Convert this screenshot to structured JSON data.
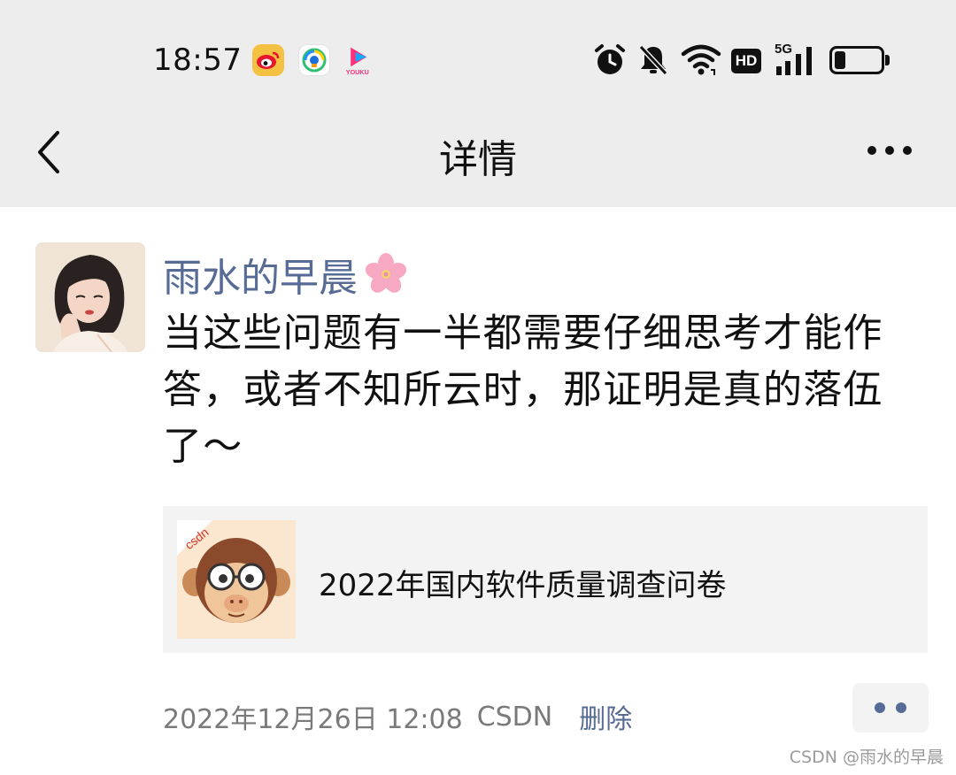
{
  "status_bar": {
    "time": "18:57",
    "apps": [
      {
        "icon": "weibo-icon"
      },
      {
        "icon": "qq-music-icon"
      },
      {
        "icon": "youku-icon",
        "label": "YOUKU"
      }
    ],
    "network": "5G",
    "hd_label": "HD",
    "battery_level": 0.2
  },
  "nav": {
    "title": "详情",
    "back_icon": "chevron-left-icon",
    "more_icon": "more-icon"
  },
  "post": {
    "username": "雨水的早晨",
    "username_emoji": "cherry-blossom-icon",
    "text": "当这些问题有一半都需要仔细思考才能作答，或者不知所云时，那证明是真的落伍了～",
    "share": {
      "thumb_label": "csdn",
      "title": "2022年国内软件质量调查问卷"
    },
    "timestamp": "2022年12月26日 12:08",
    "source": "CSDN",
    "delete_label": "删除"
  },
  "watermark": "CSDN @雨水的早晨",
  "colors": {
    "bar_bg": "#ededed",
    "link_blue": "#576b95",
    "card_bg": "#f3f3f3"
  }
}
